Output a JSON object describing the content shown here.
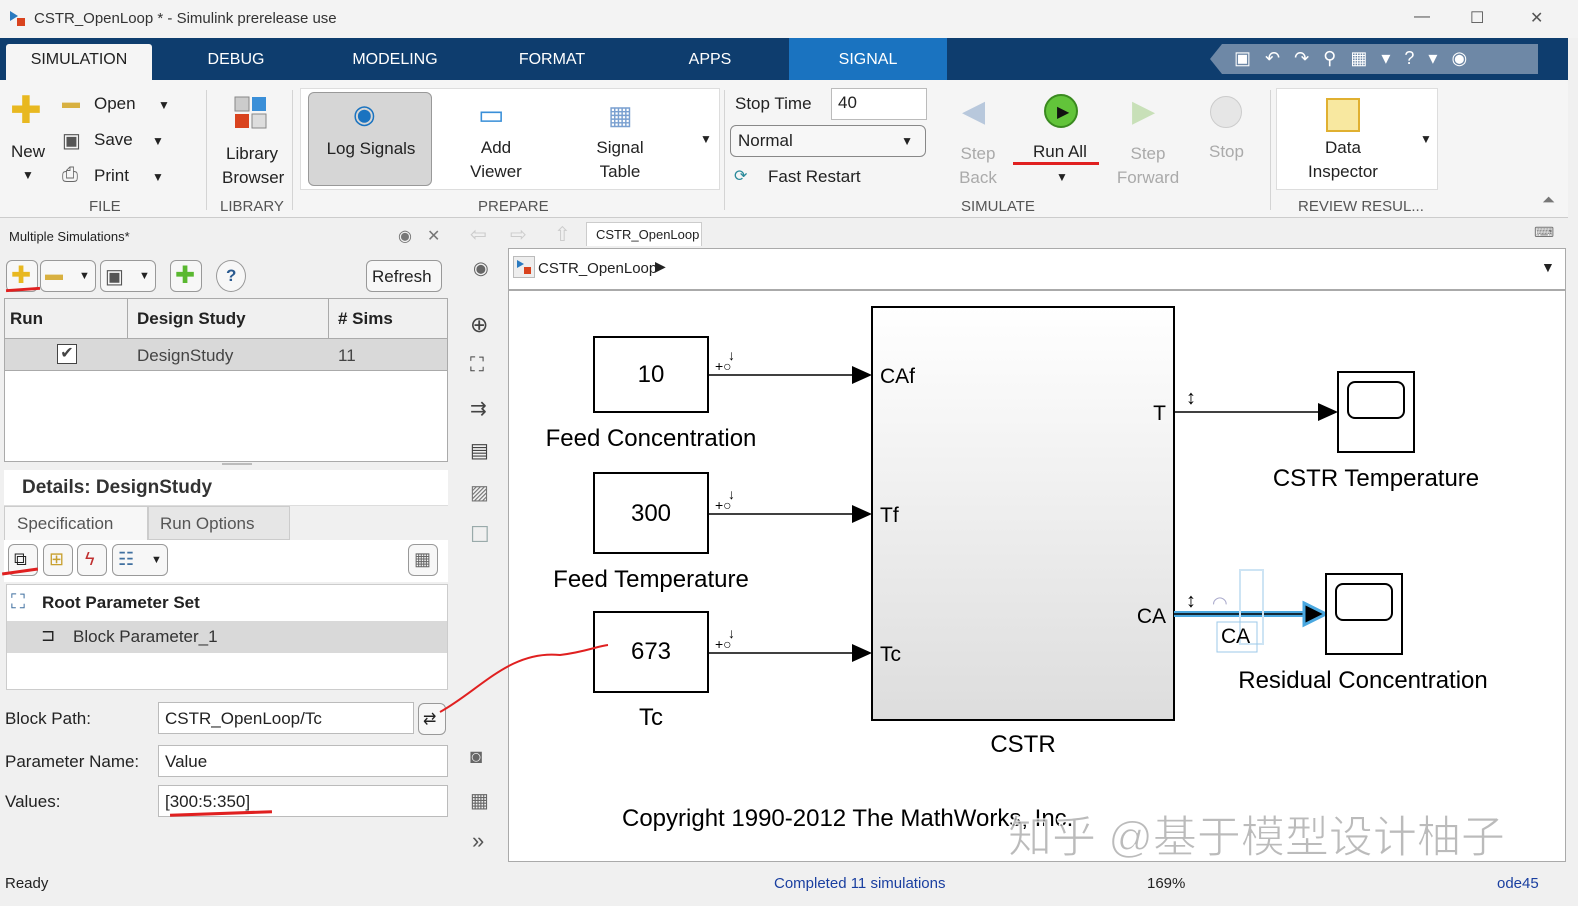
{
  "window": {
    "title": "CSTR_OpenLoop * - Simulink prerelease use",
    "minimize": "—",
    "maximize": "☐",
    "close": "✕"
  },
  "tabs": [
    {
      "label": "SIMULATION"
    },
    {
      "label": "DEBUG"
    },
    {
      "label": "MODELING"
    },
    {
      "label": "FORMAT"
    },
    {
      "label": "APPS"
    },
    {
      "label": "SIGNAL"
    }
  ],
  "ribbon": {
    "file": {
      "new": "New",
      "open": "Open",
      "save": "Save",
      "print": "Print",
      "group": "FILE"
    },
    "library": {
      "browser": "Library Browser",
      "group": "LIBRARY"
    },
    "prepare": {
      "log": "Log Signals",
      "viewer": "Add Viewer",
      "table": "Signal Table",
      "group": "PREPARE"
    },
    "simulate": {
      "stop_time_label": "Stop Time",
      "stop_time": "40",
      "mode": "Normal",
      "fast_restart": "Fast Restart",
      "step_back": "Step Back",
      "run_all": "Run All",
      "step_forward": "Step Forward",
      "stop": "Stop",
      "group": "SIMULATE"
    },
    "review": {
      "inspector": "Data Inspector",
      "group": "REVIEW RESUL..."
    }
  },
  "multisim": {
    "title": "Multiple Simulations*",
    "refresh": "Refresh",
    "columns": [
      "Run",
      "Design Study",
      "# Sims"
    ],
    "rows": [
      {
        "run": true,
        "study": "DesignStudy",
        "sims": "11"
      }
    ],
    "details_title": "Details: DesignStudy",
    "detail_tabs": [
      "Specification",
      "Run Options"
    ],
    "tree": {
      "root": "Root Parameter Set",
      "child": "Block Parameter_1"
    },
    "block_path_label": "Block Path:",
    "block_path": "CSTR_OpenLoop/Tc",
    "param_name_label": "Parameter Name:",
    "param_name": "Value",
    "values_label": "Values:",
    "values": "[300:5:350]"
  },
  "editor": {
    "tab": "CSTR_OpenLoop",
    "breadcrumb": "CSTR_OpenLoop"
  },
  "diagram": {
    "blocks": [
      {
        "value": "10",
        "label": "Feed Concentration"
      },
      {
        "value": "300",
        "label": "Feed Temperature"
      },
      {
        "value": "673",
        "label": "Tc"
      }
    ],
    "cstr": {
      "label": "CSTR",
      "inputs": [
        "CAf",
        "Tf",
        "Tc"
      ],
      "outputs": [
        "T",
        "CA"
      ]
    },
    "scopes": [
      {
        "label": "CSTR Temperature"
      },
      {
        "label": "Residual Concentration"
      }
    ],
    "signal_label": "CA",
    "copyright": "Copyright 1990-2012 The MathWorks, Inc.",
    "watermark": "知乎 @基于模型设计柚子"
  },
  "status": {
    "left": "Ready",
    "center": "Completed 11 simulations",
    "zoom": "169%",
    "solver": "ode45"
  },
  "colors": {
    "tabbar": "#0e3d6e",
    "signal_tab": "#1a73c0",
    "annotation": "#e02020",
    "signal_highlight": "#4aa8e0"
  }
}
